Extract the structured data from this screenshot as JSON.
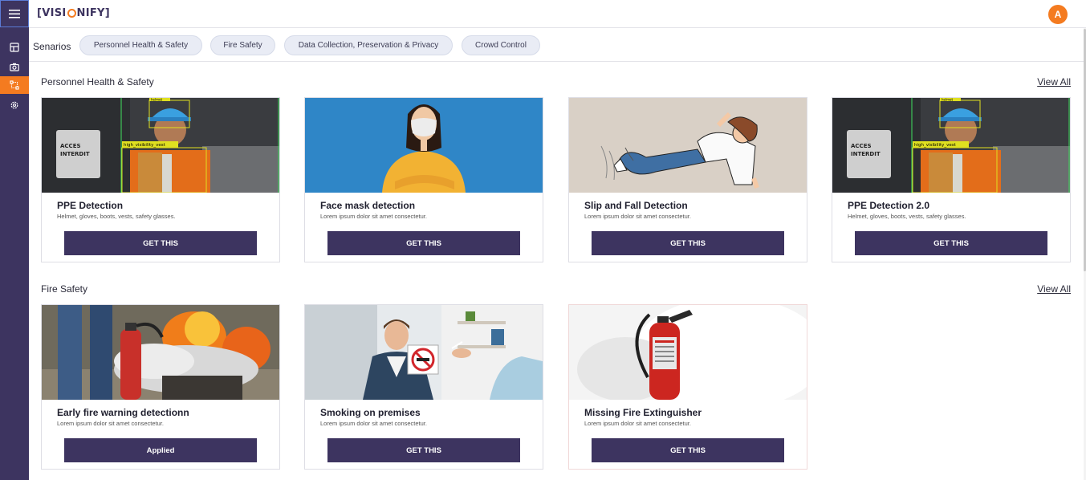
{
  "app": {
    "logo_left": "[VISI",
    "logo_right": "NIFY]",
    "avatar_initial": "A"
  },
  "sidebar": {
    "items": [
      {
        "name": "dashboard-icon",
        "active": false
      },
      {
        "name": "camera-icon",
        "active": false
      },
      {
        "name": "scenarios-icon",
        "active": true
      },
      {
        "name": "settings-icon",
        "active": false
      }
    ]
  },
  "scenarios": {
    "label": "Senarios",
    "chips": [
      "Personnel Health & Safety",
      "Fire Safety",
      "Data Collection, Preservation & Privacy",
      "Crowd Control"
    ]
  },
  "sections": [
    {
      "title": "Personnel Health & Safety",
      "view_all": "View All",
      "cards": [
        {
          "title": "PPE Detection",
          "desc": "Helmet, gloves, boots, vests, safety glasses.",
          "button": "GET THIS",
          "image": "ppe-worker"
        },
        {
          "title": "Face mask detection",
          "desc": "Lorem ipsum dolor sit amet consectetur.",
          "button": "GET THIS",
          "image": "woman-mask"
        },
        {
          "title": "Slip and Fall Detection",
          "desc": "Lorem ipsum dolor sit amet consectetur.",
          "button": "GET THIS",
          "image": "falling-person"
        },
        {
          "title": "PPE Detection 2.0",
          "desc": "Helmet, gloves, boots, vests, safety glasses.",
          "button": "GET THIS",
          "image": "ppe-worker"
        }
      ]
    },
    {
      "title": "Fire Safety",
      "view_all": "View All",
      "cards": [
        {
          "title": "Early fire warning detectionn",
          "desc": "Lorem ipsum dolor sit amet consectetur.",
          "button": "Applied",
          "image": "fire-extinguishing"
        },
        {
          "title": "Smoking on premises",
          "desc": "Lorem ipsum dolor sit amet consectetur.",
          "button": "GET THIS",
          "image": "no-smoking-sign"
        },
        {
          "title": "Missing Fire Extinguisher",
          "desc": "Lorem ipsum dolor sit amet consectetur.",
          "button": "GET THIS",
          "image": "fire-extinguisher"
        }
      ]
    }
  ],
  "image_labels": {
    "helmet": "helmet",
    "vest": "high_visibility_vest",
    "sign_line1": "ACCES",
    "sign_line2": "INTERDIT"
  },
  "colors": {
    "brand": "#3d3460",
    "accent": "#f47b20",
    "chip_bg": "#e9ecf5"
  }
}
